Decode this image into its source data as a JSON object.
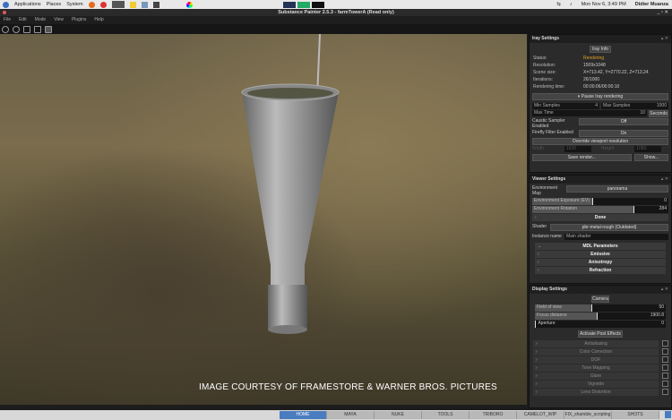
{
  "topbar": {
    "applications": "Applications",
    "places": "Places",
    "system": "System",
    "datetime": "Mon Nov  6,  3:49 PM",
    "user": "Didier Muanza"
  },
  "window": {
    "title": "Substance Painter 2.5.3 - farmTowerA (Read only)"
  },
  "menu": [
    "File",
    "Edit",
    "Mode",
    "View",
    "Plugins",
    "Help"
  ],
  "viewport": {
    "credit": "IMAGE COURTESY OF FRAMESTORE & WARNER BROS. PICTURES"
  },
  "iray": {
    "header": "Iray Settings",
    "info_button": "Iray Info",
    "stats": [
      {
        "k": "Status:",
        "v": "Rendering"
      },
      {
        "k": "Resolution:",
        "v": "1509x1048"
      },
      {
        "k": "Scene size:",
        "v": "X=713.42, Y=2770.22, Z=713.24"
      },
      {
        "k": "Iterations:",
        "v": "26/1000"
      },
      {
        "k": "Rendering time:",
        "v": "00:00:06/00:00:10"
      }
    ],
    "pause": "Pause Iray rendering",
    "min_samples": "Min Samples",
    "min_samples_val": "4",
    "max_samples": "Max Samples",
    "max_samples_val": "1000",
    "max_time": "Max Time",
    "max_time_val": "10",
    "time_unit": "Seconds",
    "caustic": "Caustic Sampler Enabled",
    "caustic_val": "Off",
    "firefly": "Firefly Filter Enabled",
    "firefly_val": "On",
    "override": "Override viewport resolution",
    "width": "Width",
    "width_val": "1920",
    "height": "Height",
    "height_val": "1080",
    "save": "Save render...",
    "show": "Show..."
  },
  "viewer": {
    "header": "Viewer Settings",
    "env_map": "Environment Map",
    "env_map_val": "panorama",
    "exposure": "Environment Exposure (EV)",
    "exposure_val": "0",
    "rotation": "Environment Rotation",
    "rotation_val": "284",
    "done": "Done",
    "shader": "Shader",
    "shader_val": "pbr-metal-rough (Outdated)",
    "instance": "Instance name",
    "instance_val": "Main shader",
    "mdl": "MDL Parameters",
    "sections": [
      "Emissive",
      "Anisotropy",
      "Refraction"
    ]
  },
  "display": {
    "header": "Display Settings",
    "camera": "Camera",
    "fov": "Field of view",
    "fov_val": "50",
    "focus": "Focus distance",
    "focus_val": "1900.8",
    "aperture": "Aperture",
    "aperture_val": "0",
    "post": "Activate Post Effects",
    "effects": [
      "Antialiasing",
      "Color Correction",
      "DOF",
      "Tone Mapping",
      "Glare",
      "Vignette",
      "Lens Distortion"
    ]
  },
  "taskbar": [
    "HOME",
    "MAYA",
    "NUKE",
    "TOOLS",
    "TRIBORO",
    "CAMELOT_WIP",
    "FIX_shamble_scripting",
    "SHOTS"
  ],
  "colors": {
    "accent": "#4a7cc0",
    "status": "#e0a020"
  }
}
